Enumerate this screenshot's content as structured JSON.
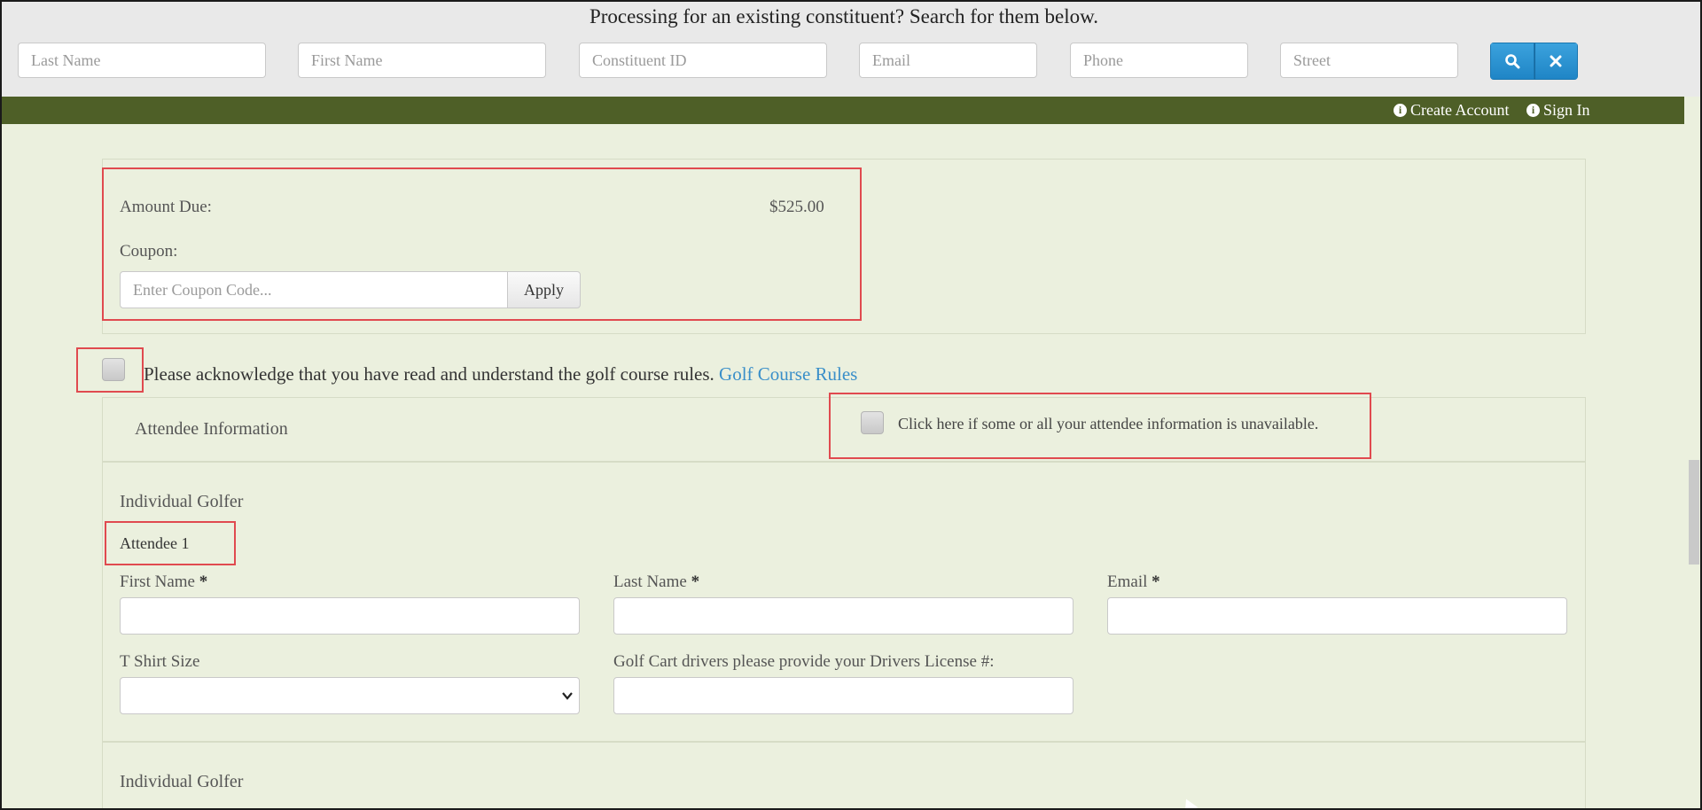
{
  "search": {
    "title": "Processing for an existing constituent? Search for them below.",
    "fields": [
      {
        "placeholder": "Last Name"
      },
      {
        "placeholder": "First Name"
      },
      {
        "placeholder": "Constituent ID"
      },
      {
        "placeholder": "Email"
      },
      {
        "placeholder": "Phone"
      },
      {
        "placeholder": "Street"
      }
    ],
    "search_icon": "search-icon",
    "clear_icon": "close-icon",
    "button_color": "#2a8fd0"
  },
  "nav": {
    "bg_color": "#4e5f27",
    "create_account": "Create Account",
    "sign_in": "Sign In",
    "info_glyph": "i"
  },
  "payment": {
    "amount_label": "Amount Due:",
    "amount_value": "$525.00",
    "coupon_label": "Coupon:",
    "coupon_placeholder": "Enter Coupon Code...",
    "apply_label": "Apply"
  },
  "rules": {
    "text": "Please acknowledge that you have read and understand the golf course rules.",
    "link": "Golf Course Rules",
    "checked": false
  },
  "attendee": {
    "section_title": "Attendee Information",
    "unavailable_label": "Click here if some or all your attendee information is unavailable.",
    "group1_title": "Individual Golfer",
    "attendee1_label": "Attendee 1",
    "first_name_label": "First Name",
    "last_name_label": "Last Name",
    "email_label": "Email",
    "required_mark": "*",
    "tshirt_label": "T Shirt Size",
    "license_label": "Golf Cart drivers please provide your Drivers License #:",
    "group2_title": "Individual Golfer"
  },
  "colors": {
    "highlight": "#e04a4f",
    "page_bg": "#ebf0de",
    "green_text": "#6e8a3e",
    "link": "#3a8fc9"
  }
}
